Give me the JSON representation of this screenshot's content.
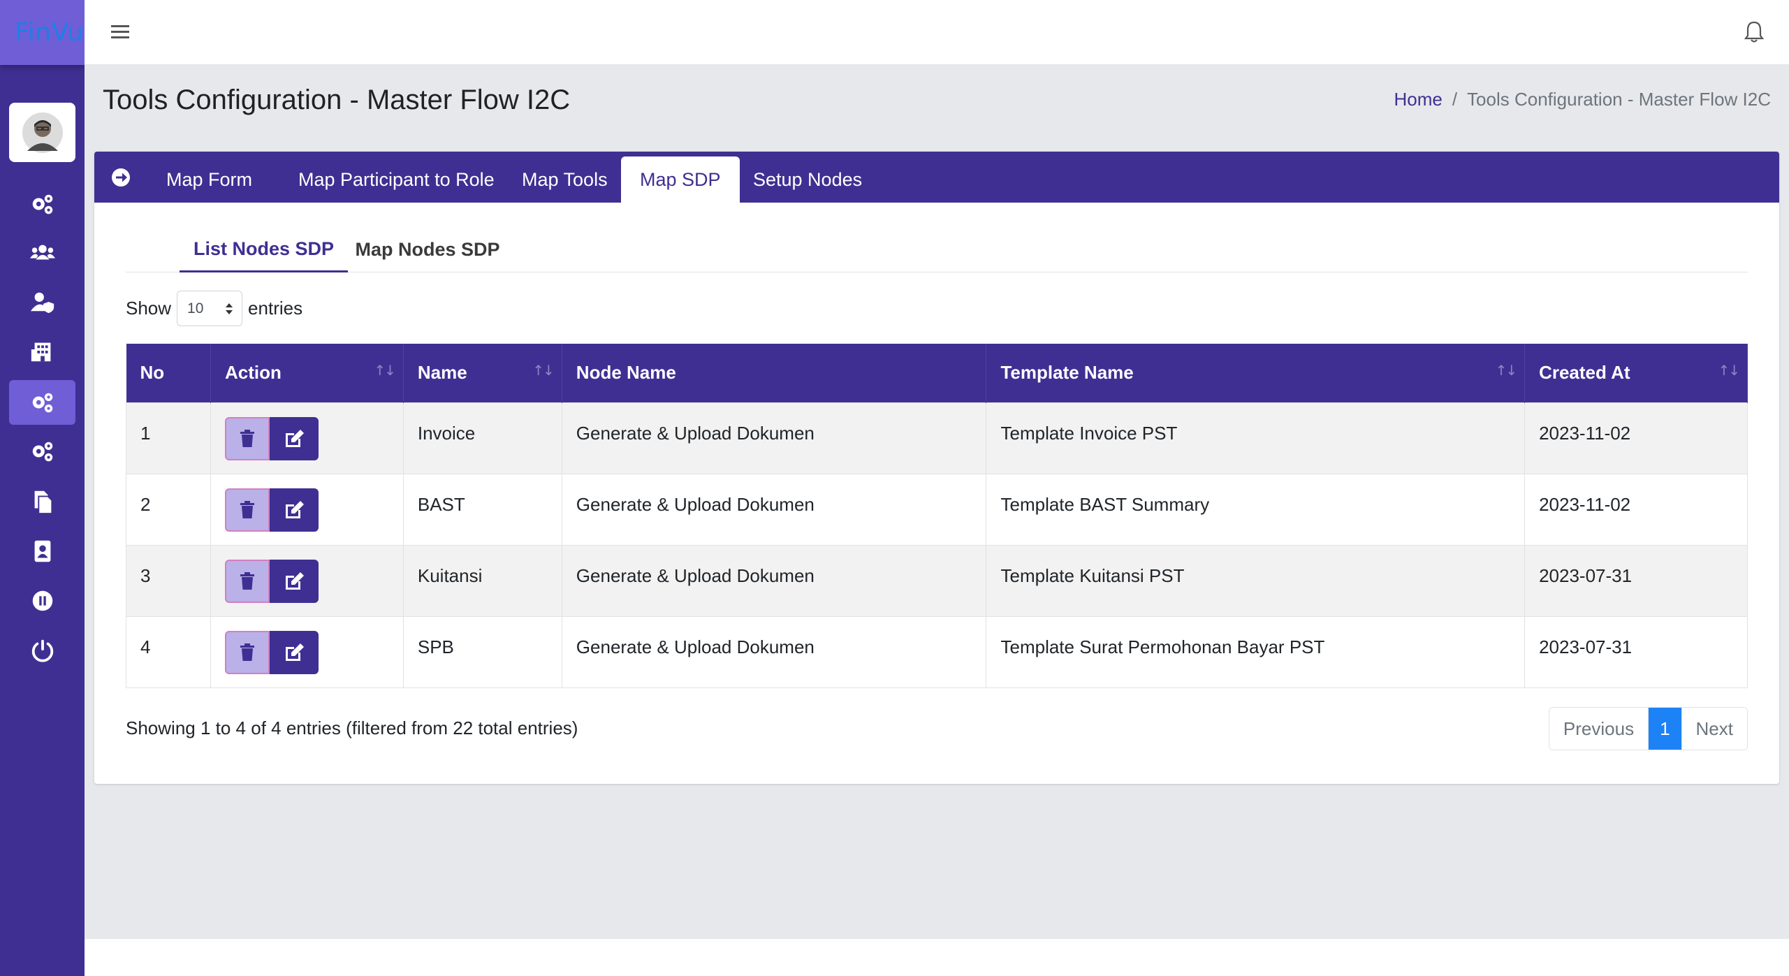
{
  "brand": {
    "text": "FinVu"
  },
  "header": {
    "title": "Tools Configuration - Master Flow I2C"
  },
  "breadcrumb": {
    "home": "Home",
    "separator": "/",
    "current": "Tools Configuration - Master Flow I2C"
  },
  "sidebar": {
    "items": [
      {
        "icon": "gears-icon",
        "active": false
      },
      {
        "icon": "users-icon",
        "active": false
      },
      {
        "icon": "user-shield-icon",
        "active": false
      },
      {
        "icon": "building-icon",
        "active": false
      },
      {
        "icon": "gears-icon",
        "active": true
      },
      {
        "icon": "gears-icon",
        "active": false
      },
      {
        "icon": "copy-icon",
        "active": false
      },
      {
        "icon": "address-book-icon",
        "active": false
      },
      {
        "icon": "pause-circle-icon",
        "active": false
      },
      {
        "icon": "power-icon",
        "active": false
      }
    ]
  },
  "tabs": [
    {
      "label": "Map Form",
      "active": false
    },
    {
      "label": "Map Participant to Role",
      "active": false
    },
    {
      "label": "Map Tools",
      "active": false
    },
    {
      "label": "Map SDP",
      "active": true
    },
    {
      "label": "Setup Nodes",
      "active": false
    }
  ],
  "sub_tabs": [
    {
      "label": "List Nodes SDP",
      "active": true
    },
    {
      "label": "Map Nodes SDP",
      "active": false
    }
  ],
  "length_menu": {
    "prefix": "Show",
    "value": "10",
    "suffix": "entries"
  },
  "table": {
    "headers": [
      "No",
      "Action",
      "Name",
      "Node Name",
      "Template Name",
      "Created At"
    ],
    "rows": [
      {
        "no": "1",
        "name": "Invoice",
        "node_name": "Generate & Upload Dokumen",
        "template_name": "Template Invoice PST",
        "created_at": "2023-11-02"
      },
      {
        "no": "2",
        "name": "BAST",
        "node_name": "Generate & Upload Dokumen",
        "template_name": "Template BAST Summary",
        "created_at": "2023-11-02"
      },
      {
        "no": "3",
        "name": "Kuitansi",
        "node_name": "Generate & Upload Dokumen",
        "template_name": "Template Kuitansi PST",
        "created_at": "2023-07-31"
      },
      {
        "no": "4",
        "name": "SPB",
        "node_name": "Generate & Upload Dokumen",
        "template_name": "Template Surat Permohonan Bayar PST",
        "created_at": "2023-07-31"
      }
    ],
    "info": "Showing 1 to 4 of 4 entries (filtered from 22 total entries)"
  },
  "pagination": {
    "previous": "Previous",
    "current": "1",
    "next": "Next"
  },
  "colors": {
    "primary": "#3f2f92",
    "accent": "#6f5ed6",
    "pagination_active": "#1d82f5",
    "content_bg": "#e7e8ec"
  }
}
